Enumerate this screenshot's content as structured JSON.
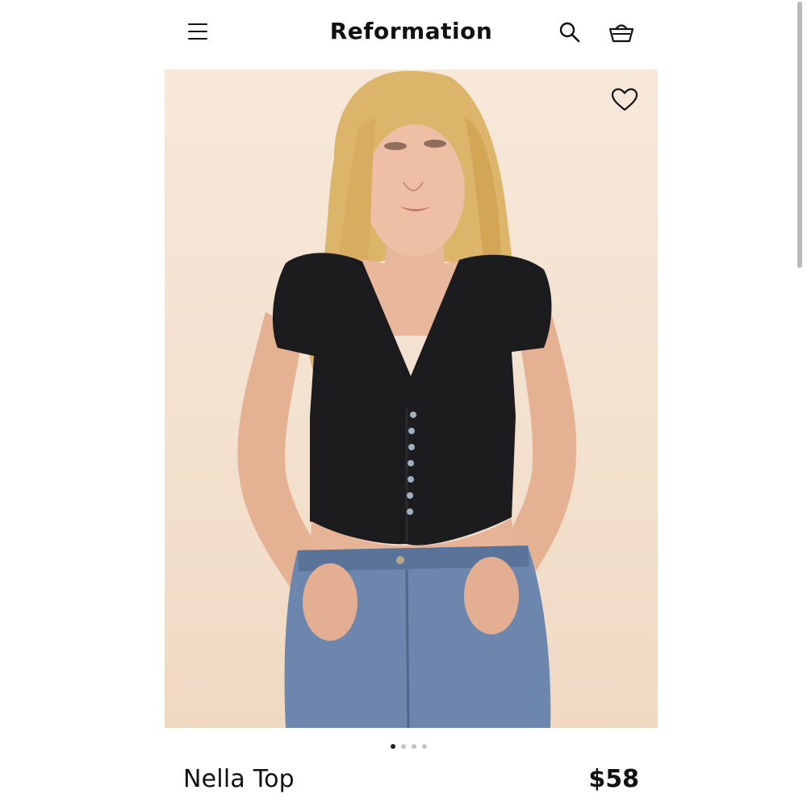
{
  "header": {
    "brand": "Reformation",
    "icons": {
      "menu": "menu-icon",
      "search": "search-icon",
      "bag": "shopping-bag-icon"
    }
  },
  "product": {
    "name": "Nella Top",
    "price": "$58",
    "image_alt": "Model wearing black ribbed cap-sleeve button-front crop top with light blue jeans",
    "carousel": {
      "total": 4,
      "active_index": 0
    },
    "favorite_icon": "heart-icon"
  },
  "colors": {
    "background": "#ffffff",
    "text": "#111111",
    "hero_background": "#f3e1cf",
    "dot_active": "#222222",
    "dot_inactive": "#c4c4c4"
  }
}
